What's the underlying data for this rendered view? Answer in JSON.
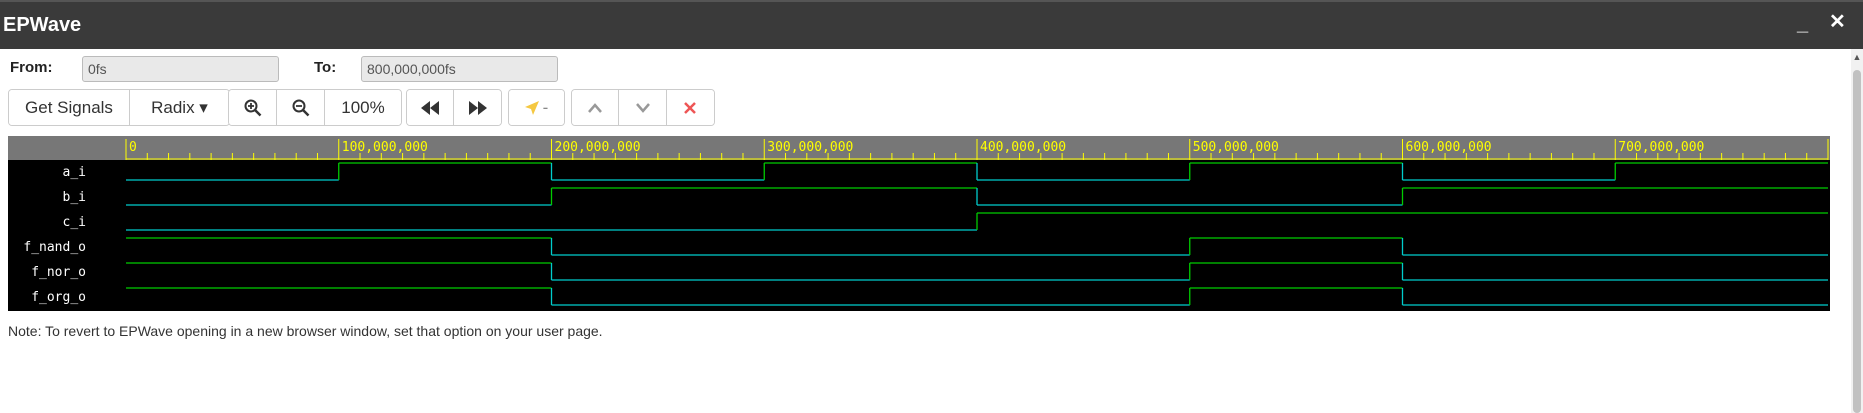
{
  "window": {
    "title": "EPWave",
    "minimize_label": "_",
    "close_label": "✕"
  },
  "range": {
    "from_label": "From:",
    "from_value": "0fs",
    "to_label": "To:",
    "to_value": "800,000,000fs"
  },
  "toolbar": {
    "get_signals_label": "Get Signals",
    "radix_label": "Radix ▾",
    "zoom_in_icon": "zoom-in-icon",
    "zoom_out_icon": "zoom-out-icon",
    "zoom_level": "100%",
    "prev_edge_icon": "rewind-icon",
    "next_edge_icon": "fast-forward-icon",
    "cursor_label": "-",
    "move_up_icon": "chevron-up-icon",
    "move_down_icon": "chevron-down-icon",
    "remove_icon": "close-icon"
  },
  "waveform": {
    "time_end": 800000000,
    "ruler_labels": [
      "0",
      "100,000,000",
      "200,000,000",
      "300,000,000",
      "400,000,000",
      "500,000,000",
      "600,000,000",
      "700,000,000"
    ],
    "signals": [
      {
        "name": "a_i",
        "transitions": [
          [
            0,
            0
          ],
          [
            100000000,
            1
          ],
          [
            200000000,
            0
          ],
          [
            300000000,
            1
          ],
          [
            400000000,
            0
          ],
          [
            500000000,
            1
          ],
          [
            600000000,
            0
          ],
          [
            700000000,
            1
          ]
        ]
      },
      {
        "name": "b_i",
        "transitions": [
          [
            0,
            0
          ],
          [
            200000000,
            1
          ],
          [
            400000000,
            0
          ],
          [
            600000000,
            1
          ]
        ]
      },
      {
        "name": "c_i",
        "transitions": [
          [
            0,
            0
          ],
          [
            400000000,
            1
          ]
        ]
      },
      {
        "name": "f_nand_o",
        "transitions": [
          [
            0,
            1
          ],
          [
            200000000,
            0
          ],
          [
            500000000,
            1
          ],
          [
            600000000,
            0
          ]
        ]
      },
      {
        "name": "f_nor_o",
        "transitions": [
          [
            0,
            1
          ],
          [
            200000000,
            0
          ],
          [
            500000000,
            1
          ],
          [
            600000000,
            0
          ]
        ]
      },
      {
        "name": "f_org_o",
        "transitions": [
          [
            0,
            1
          ],
          [
            200000000,
            0
          ],
          [
            500000000,
            1
          ],
          [
            600000000,
            0
          ]
        ]
      }
    ],
    "colors": {
      "background": "#000000",
      "ruler_bg": "#777777",
      "ruler_text": "#ffff00",
      "high": "#00cc00",
      "low": "#00cccc",
      "signal_name": "#ffffff"
    }
  },
  "note": "Note: To revert to EPWave opening in a new browser window, set that option on your user page."
}
